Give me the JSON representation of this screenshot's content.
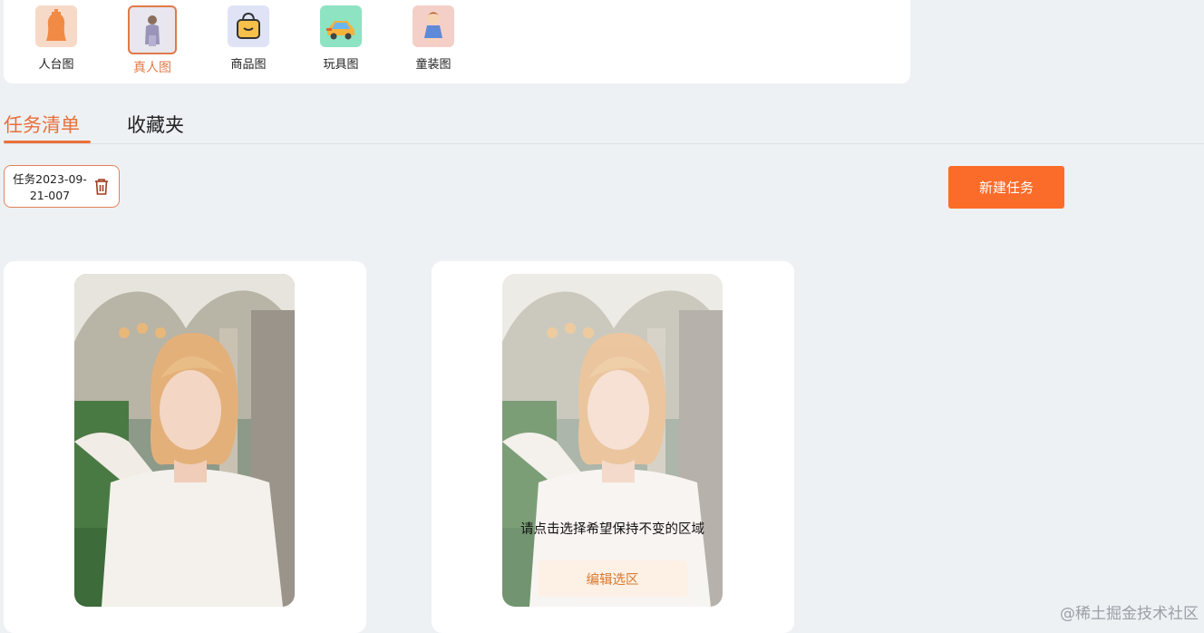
{
  "categories": [
    {
      "label": "人台图",
      "icon": "mannequin-icon",
      "bg": "#f7d9c8",
      "active": false
    },
    {
      "label": "真人图",
      "icon": "model-photo-icon",
      "bg": "#e8e6ee",
      "active": true
    },
    {
      "label": "商品图",
      "icon": "shopping-bag-icon",
      "bg": "#dfe3f5",
      "active": false
    },
    {
      "label": "玩具图",
      "icon": "toy-car-icon",
      "bg": "#8ee3c2",
      "active": false
    },
    {
      "label": "童装图",
      "icon": "child-clothing-icon",
      "bg": "#f3cfc8",
      "active": false
    }
  ],
  "tabs": {
    "task_list": "任务清单",
    "favorites": "收藏夹"
  },
  "task": {
    "name": "任务2023-09-21-007"
  },
  "new_task_label": "新建任务",
  "cards": [
    {
      "type": "original"
    },
    {
      "type": "editable",
      "hint": "请点击选择希望保持不变的区域",
      "edit_label": "编辑选区"
    }
  ],
  "watermark": "@稀土掘金技术社区",
  "colors": {
    "accent": "#e8703b",
    "button": "#fb6c2a",
    "page_bg": "#eef1f4"
  }
}
